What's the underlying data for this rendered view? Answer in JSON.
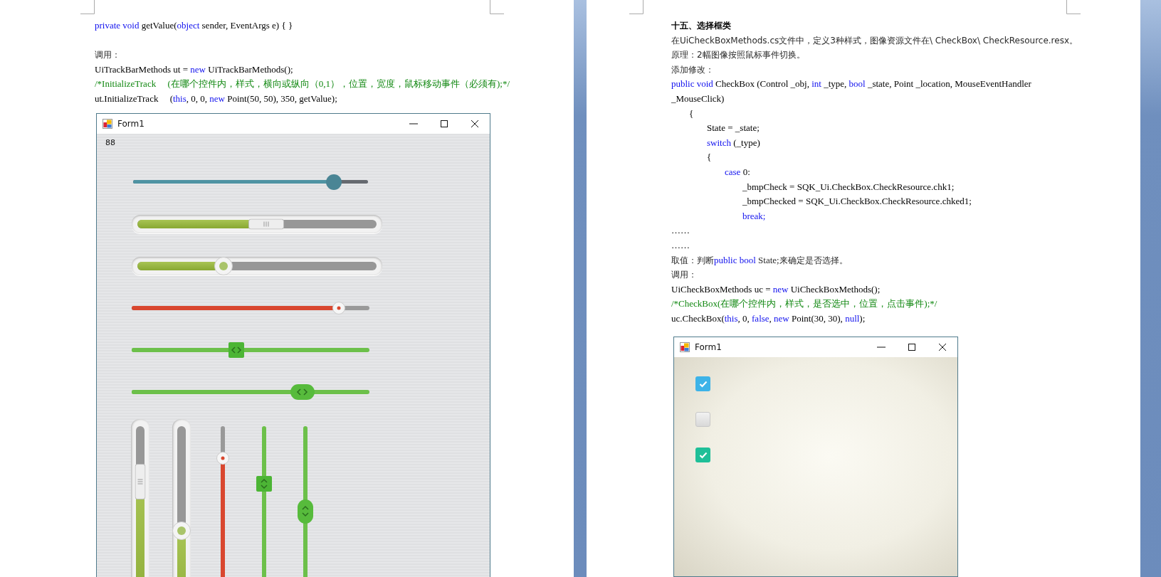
{
  "left_page": {
    "blocks": [
      {
        "lines": [
          {
            "kind": "code",
            "segments": [
              {
                "kind": "keyword",
                "text": "private void"
              },
              {
                "kind": "code",
                "text": " getValue("
              },
              {
                "kind": "keyword",
                "text": "object"
              },
              {
                "kind": "code",
                "text": " sender, EventArgs e) { }"
              }
            ]
          }
        ]
      },
      {
        "lines": [
          {
            "kind": "text",
            "segments": [
              {
                "kind": "text",
                "text": "调用："
              }
            ]
          },
          {
            "kind": "code",
            "segments": [
              {
                "kind": "code",
                "text": "UiTrackBarMethods ut = "
              },
              {
                "kind": "keyword",
                "text": "new"
              },
              {
                "kind": "code",
                "text": " UiTrackBarMethods();"
              }
            ]
          },
          {
            "kind": "code",
            "segments": [
              {
                "kind": "comment",
                "text": "/*InitializeTrack     (在哪个控件内，样式，横向或纵向（0,1），位置，宽度，鼠标移动事件（必须有);*/"
              }
            ]
          },
          {
            "kind": "code",
            "segments": [
              {
                "kind": "code",
                "text": "ut.InitializeTrack     ("
              },
              {
                "kind": "keyword",
                "text": "this"
              },
              {
                "kind": "code",
                "text": ", 0, 0, "
              },
              {
                "kind": "keyword",
                "text": "new"
              },
              {
                "kind": "code",
                "text": " Point(50, 50), 350, getValue);"
              }
            ]
          }
        ]
      }
    ],
    "form": {
      "title": "Form1",
      "value_label": "88",
      "horizontal_sliders": [
        {
          "kind": "flat-dot",
          "level": 0.85
        },
        {
          "kind": "groove-bar",
          "level": 0.54
        },
        {
          "kind": "groove-knob",
          "level": 0.36
        },
        {
          "kind": "thin-ring",
          "level": 0.87
        },
        {
          "kind": "square-grip",
          "level": 0.44
        },
        {
          "kind": "pill-grip",
          "level": 0.72
        }
      ],
      "vertical_sliders": [
        {
          "kind": "groove-bar",
          "level": 0.74
        },
        {
          "kind": "groove-knob",
          "level": 0.51
        },
        {
          "kind": "thin-ring",
          "level": 0.85
        },
        {
          "kind": "square-grip",
          "level": 0.73
        },
        {
          "kind": "pill-grip",
          "level": 0.6
        }
      ]
    }
  },
  "right_page": {
    "lines": [
      {
        "kind": "heading",
        "segments": [
          {
            "kind": "text",
            "text": "十五、选择框类"
          }
        ]
      },
      {
        "kind": "text",
        "segments": [
          {
            "kind": "text",
            "text": "在UiCheckBoxMethods.cs文件中，定义3种样式，图像资源文件在\\ CheckBox\\ CheckResource.resx。"
          }
        ]
      },
      {
        "kind": "text",
        "segments": [
          {
            "kind": "text",
            "text": "原理：2幅图像按照鼠标事件切换。"
          }
        ]
      },
      {
        "kind": "text",
        "segments": [
          {
            "kind": "text",
            "text": "添加修改："
          }
        ]
      },
      {
        "kind": "code",
        "segments": [
          {
            "kind": "keyword",
            "text": "public void"
          },
          {
            "kind": "code",
            "text": " CheckBox (Control _obj, "
          },
          {
            "kind": "keyword",
            "text": "int"
          },
          {
            "kind": "code",
            "text": " _type, "
          },
          {
            "kind": "keyword",
            "text": "bool"
          },
          {
            "kind": "code",
            "text": " _state, Point _location, MouseEventHandler"
          }
        ]
      },
      {
        "kind": "code",
        "segments": [
          {
            "kind": "code",
            "text": "_MouseClick)"
          }
        ],
        "children": [
          {
            "kind": "code",
            "segments": [
              {
                "kind": "code",
                "text": "{"
              }
            ],
            "children": [
              {
                "kind": "code",
                "segments": [
                  {
                    "kind": "code",
                    "text": "State = _state;"
                  }
                ]
              },
              {
                "kind": "code",
                "segments": [
                  {
                    "kind": "keyword",
                    "text": "switch"
                  },
                  {
                    "kind": "code",
                    "text": " (_type)"
                  }
                ]
              },
              {
                "kind": "code",
                "segments": [
                  {
                    "kind": "code",
                    "text": "{"
                  }
                ],
                "children": [
                  {
                    "kind": "code",
                    "segments": [
                      {
                        "kind": "keyword",
                        "text": "case"
                      },
                      {
                        "kind": "code",
                        "text": " 0:"
                      }
                    ],
                    "children": [
                      {
                        "kind": "code",
                        "segments": [
                          {
                            "kind": "code",
                            "text": "_bmpCheck = SQK_Ui.CheckBox.CheckResource.chk1;"
                          }
                        ]
                      },
                      {
                        "kind": "code",
                        "segments": [
                          {
                            "kind": "code",
                            "text": "_bmpChecked = SQK_Ui.CheckBox.CheckResource.chked1;"
                          }
                        ]
                      },
                      {
                        "kind": "code",
                        "segments": [
                          {
                            "kind": "keyword",
                            "text": "break;"
                          }
                        ]
                      }
                    ]
                  }
                ]
              }
            ]
          }
        ]
      },
      {
        "kind": "code",
        "segments": [
          {
            "kind": "code",
            "text": "……"
          }
        ]
      },
      {
        "kind": "code",
        "segments": [
          {
            "kind": "code",
            "text": "……"
          }
        ]
      },
      {
        "kind": "text",
        "segments": [
          {
            "kind": "text",
            "text": "取值：判断"
          },
          {
            "kind": "keyword",
            "text": "public bool"
          },
          {
            "kind": "code",
            "text": " State;"
          },
          {
            "kind": "text",
            "text": "来确定是否选择。"
          }
        ]
      },
      {
        "kind": "text",
        "segments": [
          {
            "kind": "text",
            "text": "调用："
          }
        ]
      },
      {
        "kind": "code",
        "segments": [
          {
            "kind": "code",
            "text": "UiCheckBoxMethods uc = "
          },
          {
            "kind": "keyword",
            "text": "new"
          },
          {
            "kind": "code",
            "text": " UiCheckBoxMethods();"
          }
        ]
      },
      {
        "kind": "code",
        "segments": [
          {
            "kind": "comment",
            "text": "/*CheckBox(在哪个控件内，样式，是否选中，位置，点击事件);*/"
          }
        ]
      },
      {
        "kind": "code",
        "segments": [
          {
            "kind": "code",
            "text": "uc.CheckBox("
          },
          {
            "kind": "keyword",
            "text": "this"
          },
          {
            "kind": "code",
            "text": ", 0, "
          },
          {
            "kind": "keyword",
            "text": "false"
          },
          {
            "kind": "code",
            "text": ", "
          },
          {
            "kind": "keyword",
            "text": "new"
          },
          {
            "kind": "code",
            "text": " Point(30, 30), "
          },
          {
            "kind": "keyword",
            "text": "null"
          },
          {
            "kind": "code",
            "text": ");"
          }
        ]
      }
    ],
    "form": {
      "title": "Form1",
      "checkboxes": [
        {
          "checked": true,
          "color": "#3db3e8"
        },
        {
          "checked": false
        },
        {
          "checked": true,
          "color": "#1fbf98"
        }
      ]
    }
  }
}
